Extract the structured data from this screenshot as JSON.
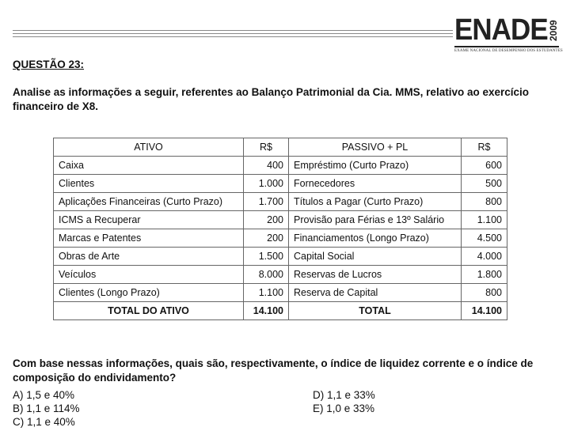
{
  "logo": {
    "word": "ENADE",
    "year": "2009",
    "subtitle": "EXAME NACIONAL DE DESEMPENHO DOS ESTUDANTES"
  },
  "question": {
    "label": "QUESTÃO 23:",
    "intro": "Analise as informações a seguir, referentes ao Balanço Patrimonial da Cia. MMS, relativo ao exercício financeiro de X8.",
    "prompt": "Com base nessas informações, quais são, respectivamente, o índice de liquidez corrente e o índice de composição do endividamento?"
  },
  "table": {
    "headers": [
      "ATIVO",
      "R$",
      "PASSIVO + PL",
      "R$"
    ],
    "rows": [
      [
        "Caixa",
        "400",
        "Empréstimo (Curto Prazo)",
        "600"
      ],
      [
        "Clientes",
        "1.000",
        "Fornecedores",
        "500"
      ],
      [
        "Aplicações Financeiras (Curto Prazo)",
        "1.700",
        "Títulos a Pagar (Curto Prazo)",
        "800"
      ],
      [
        "ICMS a Recuperar",
        "200",
        "Provisão para Férias e 13º Salário",
        "1.100"
      ],
      [
        "Marcas e Patentes",
        "200",
        "Financiamentos (Longo Prazo)",
        "4.500"
      ],
      [
        "Obras de Arte",
        "1.500",
        "Capital Social",
        "4.000"
      ],
      [
        "Veículos",
        "8.000",
        "Reservas de Lucros",
        "1.800"
      ],
      [
        "Clientes (Longo Prazo)",
        "1.100",
        "Reserva de Capital",
        "800"
      ]
    ],
    "total": [
      "TOTAL DO ATIVO",
      "14.100",
      "TOTAL",
      "14.100"
    ]
  },
  "options": {
    "a": "A) 1,5 e 40%",
    "b": "B) 1,1 e 114%",
    "c": "C) 1,1 e 40%",
    "d": "D) 1,1 e 33%",
    "e": "E) 1,0 e 33%"
  }
}
